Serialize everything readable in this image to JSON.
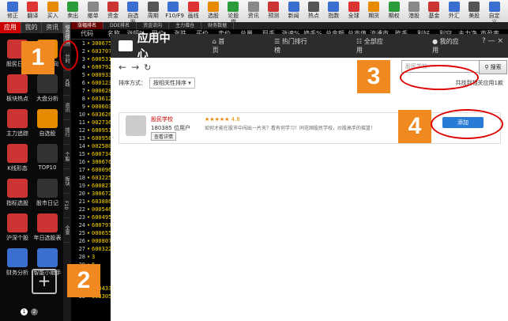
{
  "toolbar": {
    "items": [
      "修正",
      "翻译",
      "买入",
      "卖出",
      "撤单",
      "资金",
      "自选股",
      "周期",
      "F10/F9",
      "画线",
      "选股",
      "论股堂",
      "资讯",
      "预测",
      "新闻",
      "热点",
      "指数",
      "全球",
      "期货",
      "期权",
      "港股",
      "基金",
      "外汇",
      "美股",
      "自定义"
    ]
  },
  "sidebar": {
    "tabs": [
      "应用",
      "我的",
      "资讯"
    ],
    "apps": [
      "股民日报",
      "资金流向",
      "板块热点",
      "大盘分析",
      "主力追踪",
      "自选股",
      "K线形态",
      "TOP10",
      "指标选股",
      "股市日记",
      "沪深个股",
      "年日选股表",
      "财务分析",
      "智能小助手",
      "添加应用"
    ],
    "pager": [
      "1",
      "2"
    ]
  },
  "vtabs": [
    "综合排名",
    "分时",
    "K线",
    "资讯",
    "排行",
    "个股",
    "板块",
    "F10",
    "全景"
  ],
  "stock_tabs": [
    "涨幅排名",
    "DDE排名",
    "资金流向",
    "主力增仓",
    "财务数据"
  ],
  "stock_head": [
    "代码",
    "名称",
    "涨幅%",
    "现价",
    "涨跌",
    "买价",
    "卖价",
    "总量",
    "现手",
    "涨速%",
    "换手%",
    "总金额",
    "总市值",
    "流通市值",
    "昨手",
    "利好",
    "利空",
    "主力净量",
    "市盈率"
  ],
  "rows": [
    {
      "n": "1",
      "c": "300675"
    },
    {
      "n": "2",
      "c": "603707"
    },
    {
      "n": "3",
      "c": "600531"
    },
    {
      "n": "4",
      "c": "600792"
    },
    {
      "n": "5",
      "c": "000933"
    },
    {
      "n": "6",
      "c": "600123"
    },
    {
      "n": "7",
      "c": "000628"
    },
    {
      "n": "8",
      "c": "603612"
    },
    {
      "n": "9",
      "c": "000603"
    },
    {
      "n": "10",
      "c": "603626"
    },
    {
      "n": "11",
      "c": "002736"
    },
    {
      "n": "12",
      "c": "600951"
    },
    {
      "n": "13",
      "c": "600958"
    },
    {
      "n": "14",
      "c": "002580"
    },
    {
      "n": "15",
      "c": "600734"
    },
    {
      "n": "16",
      "c": "300676"
    },
    {
      "n": "17",
      "c": "600096"
    },
    {
      "n": "18",
      "c": "603225"
    },
    {
      "n": "19",
      "c": "600827"
    },
    {
      "n": "20",
      "c": "300672"
    },
    {
      "n": "21",
      "c": "603886"
    },
    {
      "n": "22",
      "c": "000546"
    },
    {
      "n": "23",
      "c": "600495"
    },
    {
      "n": "24",
      "c": "600797"
    },
    {
      "n": "25",
      "c": "000655"
    },
    {
      "n": "26",
      "c": "000807"
    },
    {
      "n": "27",
      "c": "600322"
    },
    {
      "n": "28",
      "c": "3"
    },
    {
      "n": "29",
      "c": "6"
    },
    {
      "n": "30",
      "c": "6"
    },
    {
      "n": "31",
      "c": "6"
    },
    {
      "n": "32",
      "c": "300433"
    },
    {
      "n": "33",
      "c": "603305"
    }
  ],
  "appcenter": {
    "title": "应用中心",
    "nav": [
      "首页",
      "热门排行榜",
      "全部应用",
      "我的应用"
    ],
    "window_buttons": "? — ×",
    "search_placeholder": "股民学校",
    "search_button": "搜索",
    "sort_label": "排序方式：",
    "sort_value": "按相关性排序",
    "result_count": "共找到相关应用1款",
    "card": {
      "name": "股民学校",
      "users": "180385 位用户",
      "detail": "查看详情",
      "rating": "★★★★★ 4.8",
      "desc": "如何才能在股市中闯出一片天？看有何学习！同花顺股民学校，炒股高手的摇篮！",
      "add": "添加"
    }
  },
  "markers": [
    "1",
    "2",
    "3",
    "4"
  ],
  "colors": {
    "accent": "#2a7bd5",
    "marker": "#f08a20",
    "highlight": "#d00000"
  }
}
